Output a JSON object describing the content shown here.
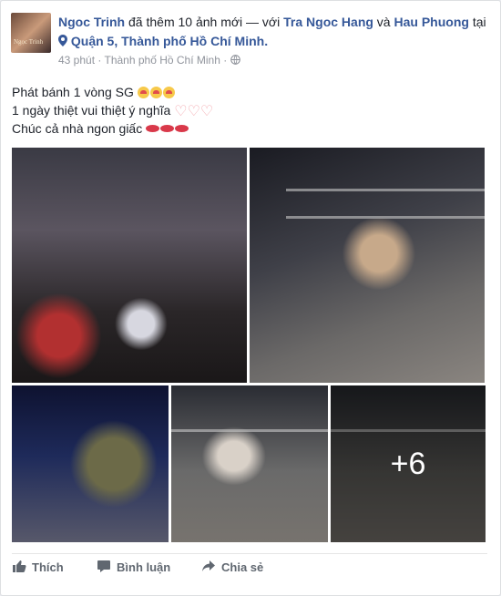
{
  "post": {
    "author": "Ngoc Trinh",
    "action_text": " đã thêm 10 ảnh mới — với ",
    "tag1": "Tra Ngoc Hang",
    "and_text": " và ",
    "tag2": "Hau Phuong",
    "at_text": " tại ",
    "location": "Quận 5, Thành phố Hồ Chí Minh.",
    "time": "43 phút",
    "meta_location": "Thành phố Hồ Chí Minh",
    "privacy_icon": "globe-icon",
    "lines": [
      "Phát bánh 1 vòng SG",
      "1 ngày thiệt vui thiệt ý nghĩa",
      "Chúc cả nhà ngon giấc"
    ],
    "more_photos": "+6"
  },
  "actions": {
    "like": "Thích",
    "comment": "Bình luận",
    "share": "Chia sẻ"
  },
  "colors": {
    "link": "#365899",
    "text": "#1d2129",
    "meta": "#90949c",
    "action": "#606770"
  }
}
